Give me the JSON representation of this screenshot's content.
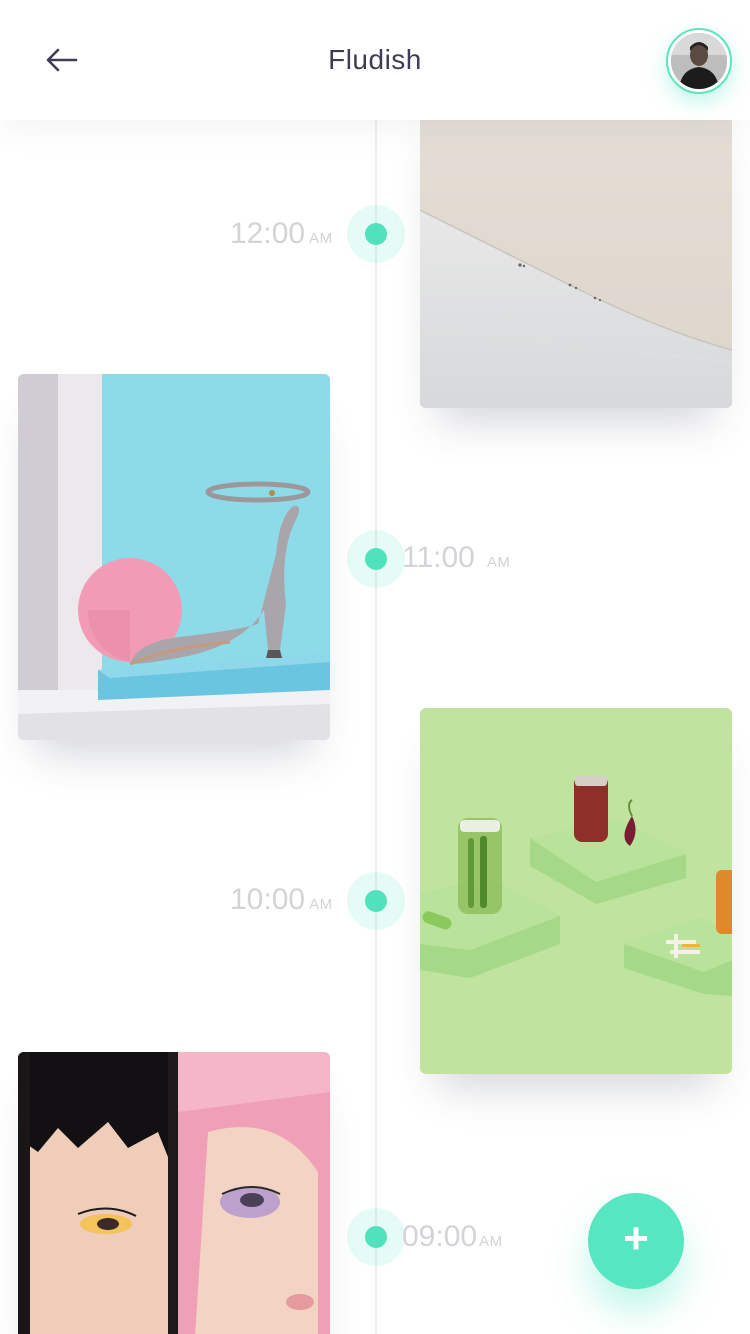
{
  "header": {
    "title": "Fludish",
    "back_icon": "arrow-left-icon",
    "avatar_icon": "user-avatar"
  },
  "timeline": [
    {
      "hour": "12:00",
      "period": "AM"
    },
    {
      "hour": "11:00",
      "period": "AM"
    },
    {
      "hour": "10:00",
      "period": "AM"
    },
    {
      "hour": "09:00",
      "period": "AM"
    }
  ],
  "cards": [
    {
      "subject": "white sand dunes"
    },
    {
      "subject": "high heel sandal with pink ball on blue block"
    },
    {
      "subject": "pickle jars on green pedestals"
    },
    {
      "subject": "two faces with colorful makeup and pink hair"
    }
  ],
  "fab": {
    "label": "+",
    "icon": "plus-icon"
  },
  "colors": {
    "accent": "#56e6c2",
    "dot": "#4fe2bc",
    "title": "#3f3d56",
    "time": "#d4d4d8"
  }
}
